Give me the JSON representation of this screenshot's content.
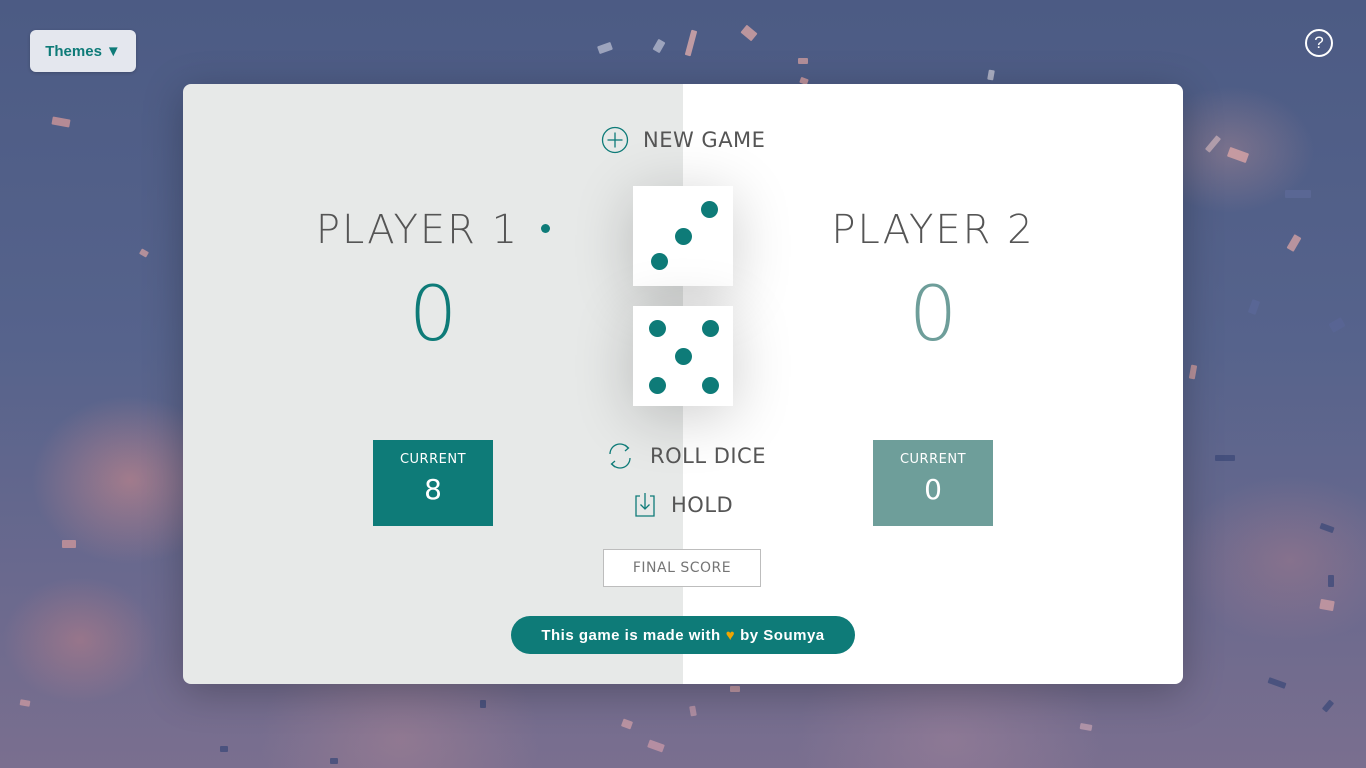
{
  "topbar": {
    "themes_label": "Themes",
    "themes_caret": "▼",
    "help_symbol": "?"
  },
  "game": {
    "new_game_label": "NEW GAME",
    "roll_dice_label": "ROLL DICE",
    "hold_label": "HOLD",
    "final_score_placeholder": "FINAL SCORE",
    "active_player": 1,
    "dice": [
      3,
      5
    ],
    "players": [
      {
        "name": "PLAYER 1",
        "score": "0",
        "current_label": "CURRENT",
        "current": "8"
      },
      {
        "name": "PLAYER 2",
        "score": "0",
        "current_label": "CURRENT",
        "current": "0"
      }
    ]
  },
  "footer": {
    "credit_prefix": "This game is made with",
    "credit_heart": "♥",
    "credit_suffix": "by Soumya"
  },
  "colors": {
    "accent": "#0e7b78",
    "accent_muted": "#6e9e9a",
    "active_panel": "#e7e9e8",
    "inactive_panel": "#ffffff",
    "heart": "#f0a500"
  }
}
